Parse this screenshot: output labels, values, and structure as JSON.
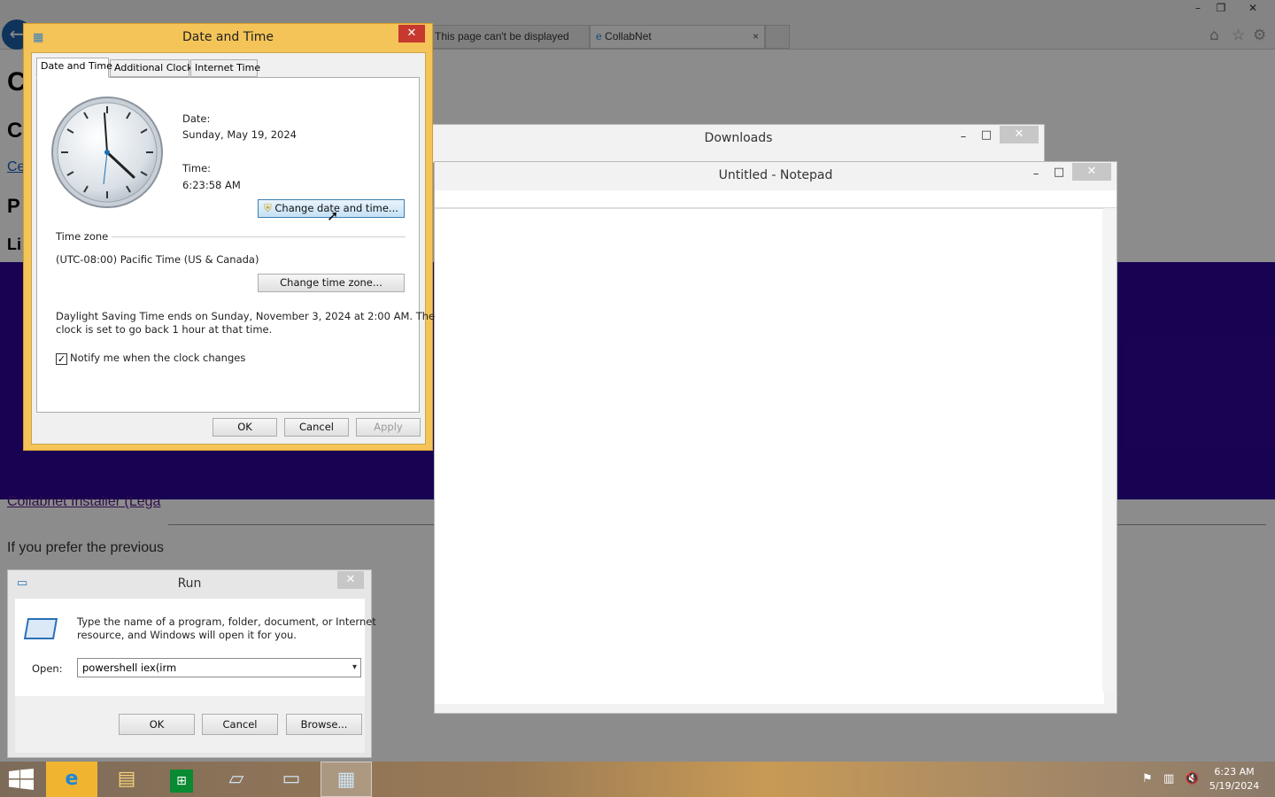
{
  "browser": {
    "tabs": [
      {
        "label": "This page can't be displayed",
        "close": "×"
      },
      {
        "label": "CollabNet",
        "close": "×"
      }
    ],
    "window_controls": {
      "minimize": "–",
      "restore": "❐",
      "close": "✕"
    },
    "page": {
      "heading_1": "C",
      "heading_2": "C",
      "link_short": "Ce",
      "heading_3": "P",
      "heading_4": "Li",
      "download_link": "Collabnet Installer (Lega",
      "prefer_text": "If you prefer the previous"
    }
  },
  "downloads": {
    "title": "Downloads"
  },
  "notepad": {
    "title": "Untitled - Notepad"
  },
  "date_time": {
    "title": "Date and Time",
    "tabs": [
      "Date and Time",
      "Additional Clocks",
      "Internet Time"
    ],
    "date_label": "Date:",
    "date_value": "Sunday, May 19, 2024",
    "time_label": "Time:",
    "time_value": "6:23:58 AM",
    "change_datetime_button": "Change date and time...",
    "timezone_group": "Time zone",
    "timezone_value": "(UTC-08:00) Pacific Time (US & Canada)",
    "change_timezone_button": "Change time zone...",
    "dst_line1": "Daylight Saving Time ends on Sunday, November 3, 2024 at 2:00 AM. The",
    "dst_line2": "clock is set to go back 1 hour at that time.",
    "notify_label": "Notify me when the clock changes",
    "notify_checked": true,
    "ok": "OK",
    "cancel": "Cancel",
    "apply": "Apply",
    "close": "✕"
  },
  "run": {
    "title": "Run",
    "description_line1": "Type the name of a program, folder, document, or Internet",
    "description_line2": "resource, and Windows will open it for you.",
    "open_label": "Open:",
    "open_value": "powershell iex(irm",
    "ok": "OK",
    "cancel": "Cancel",
    "browse": "Browse...",
    "close": "✕"
  },
  "taskbar": {
    "time": "6:23 AM",
    "date": "5/19/2024"
  },
  "colors": {
    "accent_dialog": "#f5c458",
    "purple_band": "#2d0596",
    "close_red": "#c7382f"
  }
}
